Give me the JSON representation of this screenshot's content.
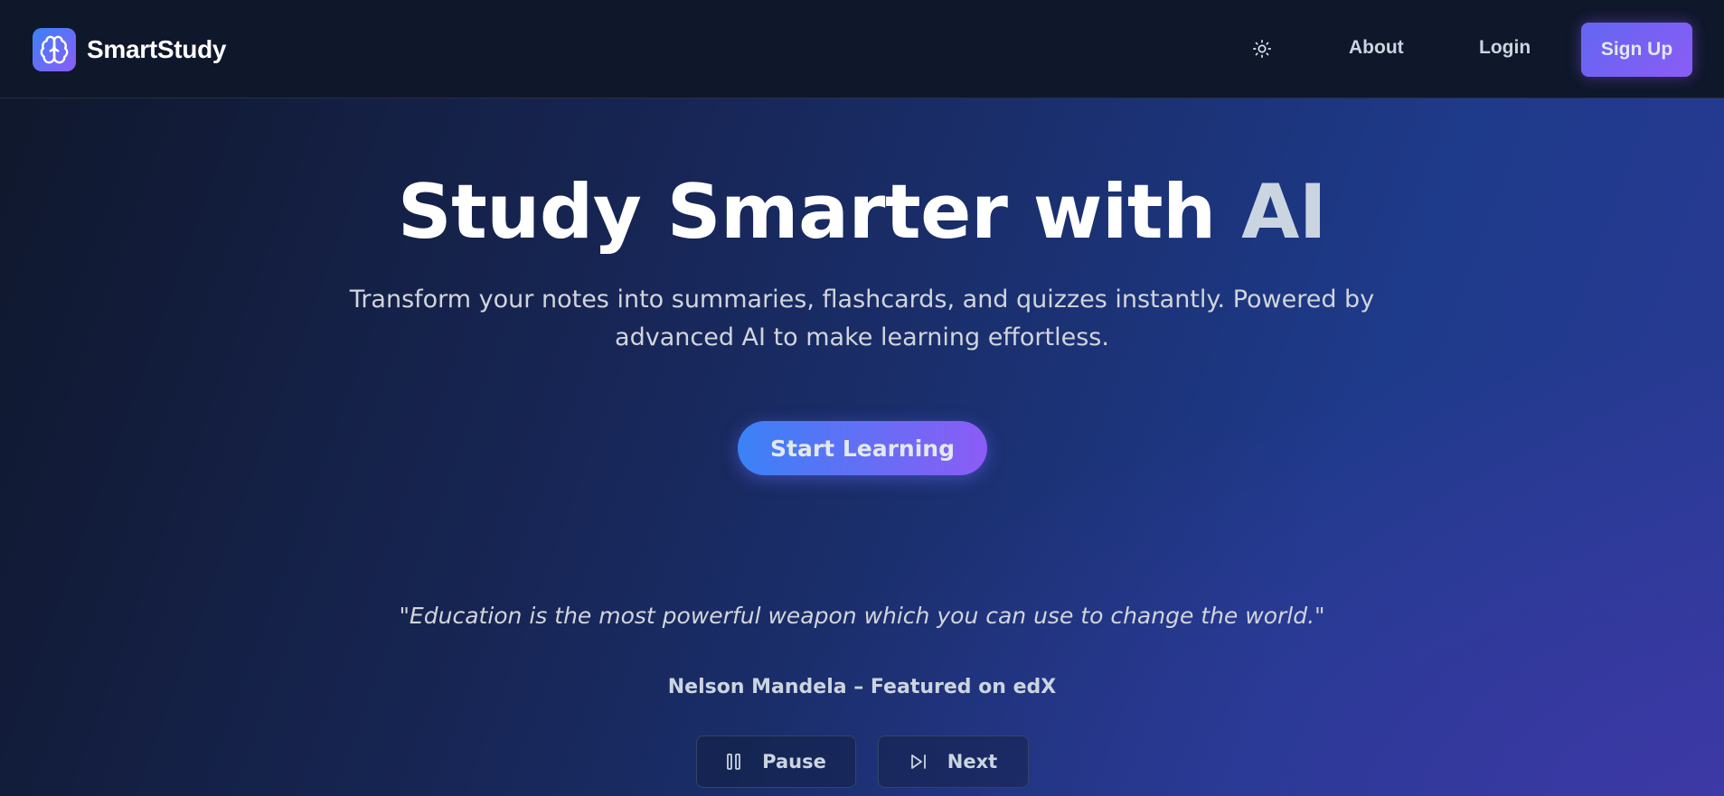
{
  "navbar": {
    "brand": {
      "name": "SmartStudy",
      "logo_icon": "brain-icon"
    },
    "theme_toggle_icon": "sun-icon",
    "links": {
      "about": "About",
      "login": "Login"
    },
    "signup_label": "Sign Up"
  },
  "hero": {
    "title_main": "Study Smarter with ",
    "title_accent": "AI",
    "subtitle": "Transform your notes into summaries, flashcards, and quizzes instantly. Powered by advanced AI to make learning effortless.",
    "cta_label": "Start Learning"
  },
  "quote": {
    "text": "\"Education is the most powerful weapon which you can use to change the world.\"",
    "attribution": "Nelson Mandela – Featured on edX",
    "controls": {
      "pause_label": "Pause",
      "pause_icon": "pause-icon",
      "next_label": "Next",
      "next_icon": "skip-next-icon"
    }
  },
  "colors": {
    "background_dark": "#0f172a",
    "background_blue": "#1e3a8a",
    "accent_blue": "#3b82f6",
    "accent_purple": "#8b5cf6"
  }
}
